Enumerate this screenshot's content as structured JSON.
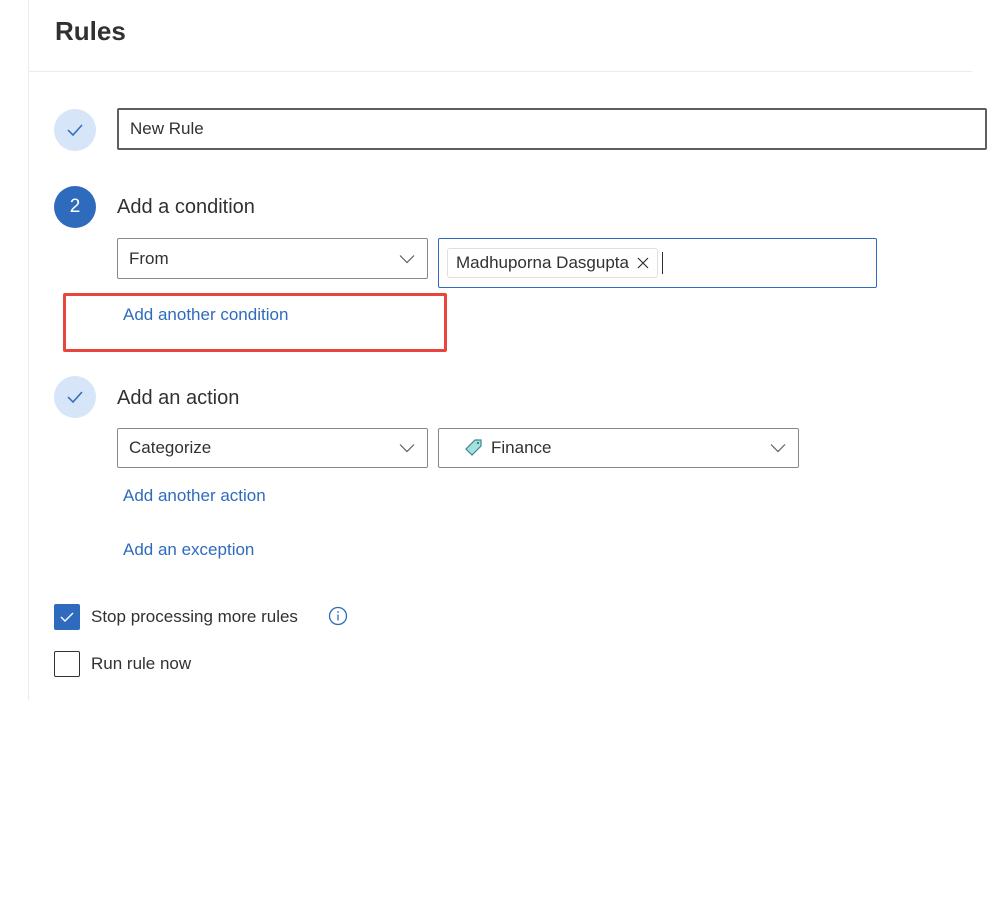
{
  "header": {
    "title": "Rules"
  },
  "rule_name": {
    "value": "New Rule"
  },
  "condition": {
    "step_number": "2",
    "title": "Add a condition",
    "type": "From",
    "recipient_chip": "Madhuporna Dasgupta",
    "add_another": "Add another condition"
  },
  "action": {
    "title": "Add an action",
    "type": "Categorize",
    "category": "Finance",
    "add_another": "Add another action",
    "add_exception": "Add an exception"
  },
  "options": {
    "stop_processing": {
      "label": "Stop processing more rules",
      "checked": true
    },
    "run_now": {
      "label": "Run rule now",
      "checked": false
    }
  },
  "colors": {
    "accent": "#2f6bbd",
    "highlight": "#e8453c",
    "tag": "#a8e0e0"
  }
}
